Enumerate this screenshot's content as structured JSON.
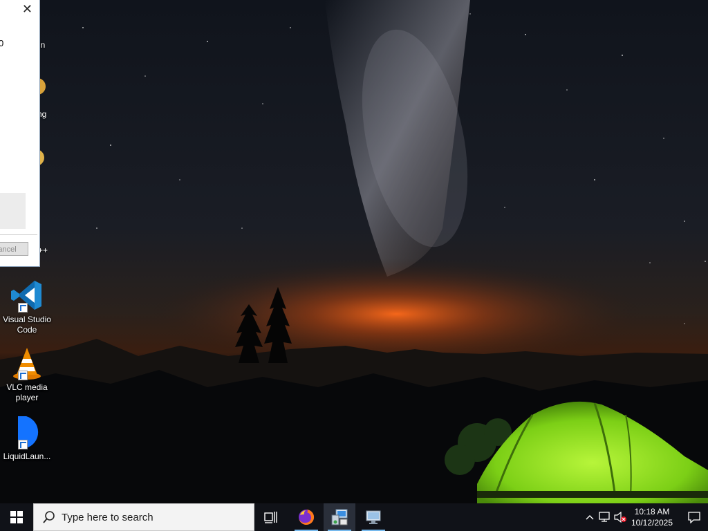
{
  "dialog": {
    "close_glyph": "✕",
    "partial_text": "0",
    "cancel_label": "ancel"
  },
  "desktop": {
    "partial_labels": [
      "in",
      "ng",
      "++"
    ],
    "icons": [
      {
        "label": "Visual Studio Code",
        "icon": "vscode-icon"
      },
      {
        "label": "VLC media player",
        "icon": "vlc-icon"
      },
      {
        "label": "LiquidLaun...",
        "icon": "liquidlauncher-icon"
      }
    ]
  },
  "taskbar": {
    "search_placeholder": "Type here to search",
    "apps": [
      {
        "name": "firefox-icon",
        "active": false
      },
      {
        "name": "control-panel-icon",
        "active": true
      },
      {
        "name": "remote-desktop-icon",
        "active": false
      }
    ],
    "clock": {
      "time": "10:18 AM",
      "date": "10/12/2025"
    }
  },
  "colors": {
    "taskbar": "#101218",
    "accent_underline": "#76b9ed",
    "vscode_blue": "#1f8ad2",
    "vlc_orange": "#f08c00",
    "liquid_blue": "#1473ff",
    "tent_green": "#8fe01c"
  }
}
